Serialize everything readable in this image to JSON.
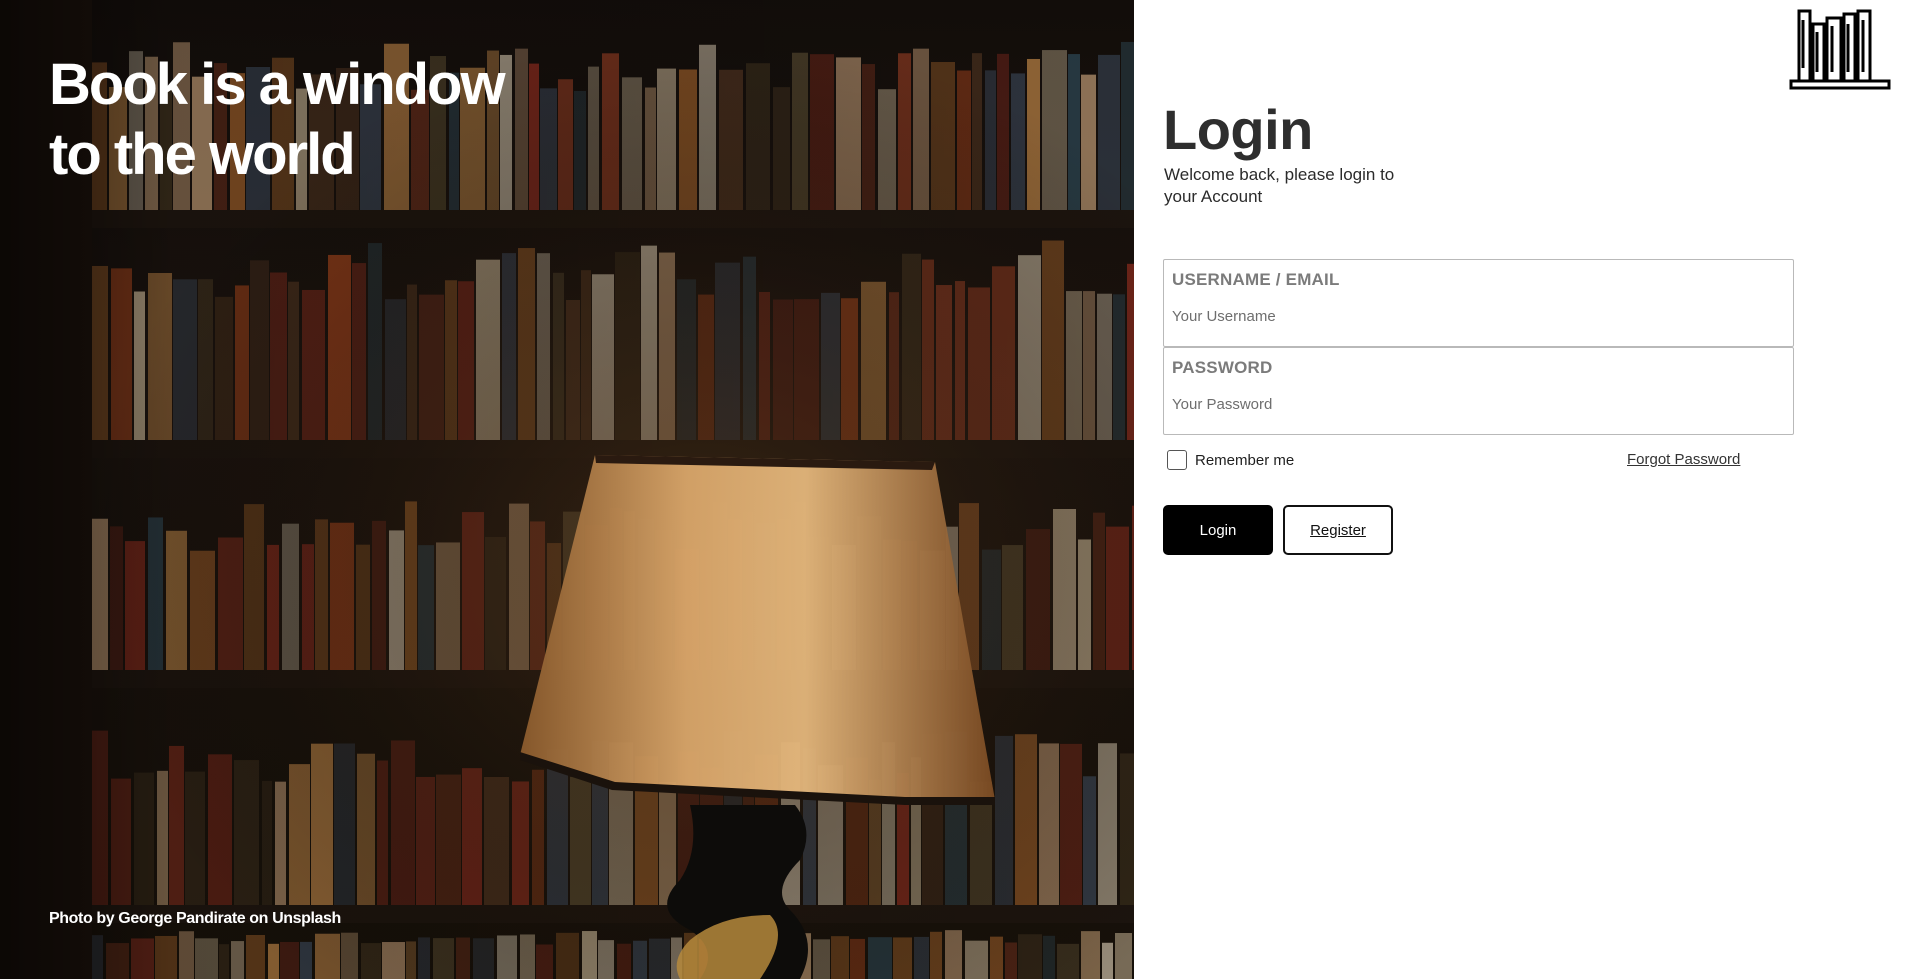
{
  "hero": {
    "title_line1": "Book is a window",
    "title_line2": "to the world",
    "credit": "Photo by George Pandirate on Unsplash"
  },
  "brand": {
    "logo_icon": "bookshelf-icon"
  },
  "login": {
    "title": "Login",
    "welcome": "Welcome back, please login to your Account",
    "username": {
      "label": "USERNAME / EMAIL",
      "placeholder": "Your Username",
      "value": ""
    },
    "password": {
      "label": "PASSWORD",
      "placeholder": "Your Password",
      "value": ""
    },
    "remember_label": "Remember me",
    "remember_checked": false,
    "forgot_label": "Forgot Password",
    "login_button": "Login",
    "register_button": "Register"
  },
  "colors": {
    "primary_button": "#000000",
    "panel_background": "#ffffff",
    "hero_text": "#ffffff"
  }
}
